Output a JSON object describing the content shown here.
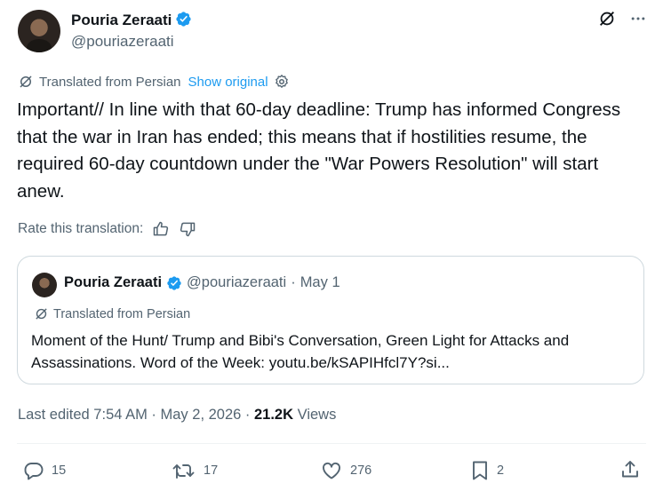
{
  "author": {
    "name": "Pouria Zeraati",
    "handle": "@pouriazeraati"
  },
  "translation": {
    "label": "Translated from Persian",
    "show_original": "Show original"
  },
  "tweet": {
    "text": "Important// In line with that 60-day deadline: Trump has informed Congress that the war in Iran has ended; this means that if hostilities resume, the required 60-day countdown under the \"War Powers Resolution\" will start anew."
  },
  "rate": {
    "label": "Rate this translation:"
  },
  "quote": {
    "name": "Pouria Zeraati",
    "handle": "@pouriazeraati",
    "separator": "·",
    "date": "May 1",
    "translated_label": "Translated from Persian",
    "text": "Moment of the Hunt/ Trump and Bibi's Conversation, Green Light for Attacks and Assassinations. Word of the Week: youtu.be/kSAPIHfcl7Y?si..."
  },
  "meta": {
    "edited": "Last edited 7:54 AM · May 2, 2026 ·",
    "views_count": "21.2K",
    "views_label": "Views"
  },
  "actions": {
    "replies": "15",
    "retweets": "17",
    "likes": "276",
    "bookmarks": "2"
  },
  "colors": {
    "accent": "#1d9bf0",
    "secondary_text": "#536471",
    "primary_text": "#0f1419"
  }
}
